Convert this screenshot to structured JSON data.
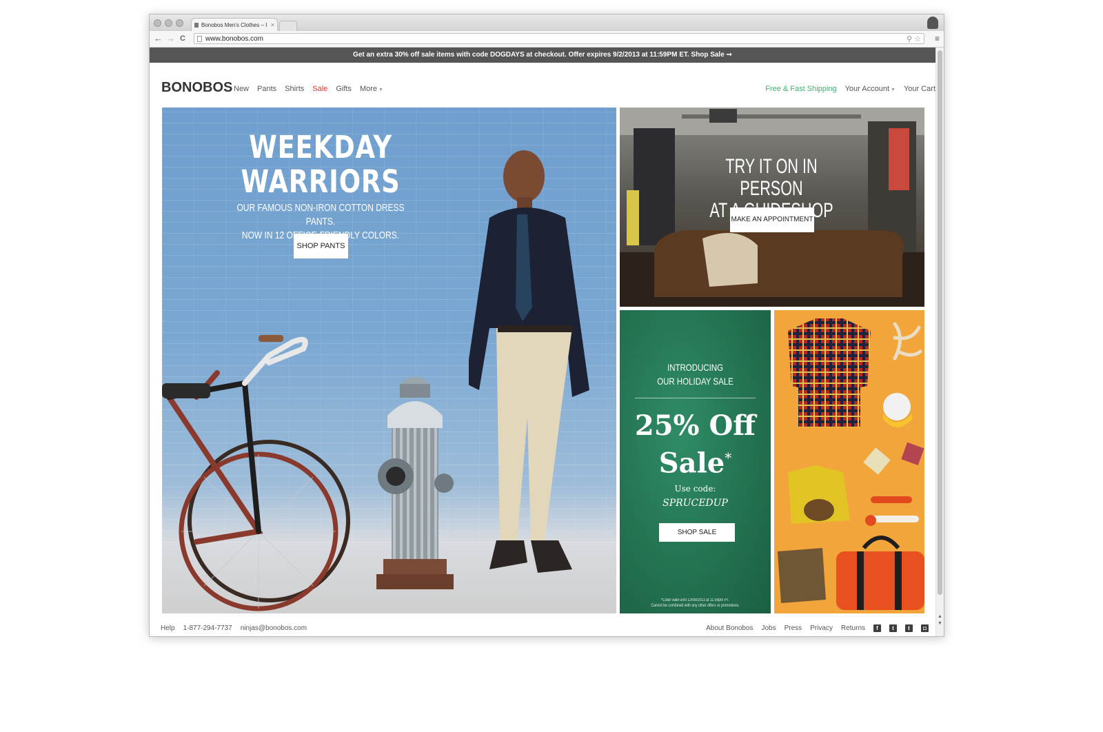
{
  "browser": {
    "tab_title": "Bonobos Men's Clothes – I",
    "tab_close": "×",
    "url": "www.bonobos.com",
    "back": "←",
    "forward": "→",
    "reload": "C",
    "omni_icons": "⚲ ☆",
    "menu": "≡"
  },
  "promo": {
    "text": "Get an extra 30% off sale items with code DOGDAYS at checkout. Offer expires 9/2/2013 at 11:59PM ET. Shop Sale ➞"
  },
  "header": {
    "logo": "BONOBOS",
    "nav": {
      "new": "New",
      "pants": "Pants",
      "shirts": "Shirts",
      "sale": "Sale",
      "gifts": "Gifts",
      "more": "More"
    },
    "util": {
      "shipping": "Free & Fast Shipping",
      "account": "Your Account",
      "cart": "Your Cart"
    },
    "colors": {
      "sale": "#e2332c",
      "shipping": "#3bb36a"
    }
  },
  "hero": {
    "title_line1": "WEEKDAY",
    "title_line2": "WARRIORS",
    "subtitle_line1": "OUR FAMOUS NON-IRON COTTON DRESS PANTS.",
    "subtitle_line2": "NOW IN 12 OFFICE-FRIENDLY COLORS.",
    "button": "SHOP PANTS"
  },
  "guideshop": {
    "title_line1": "TRY IT ON IN PERSON",
    "title_line2": "AT A GUIDESHOP",
    "button": "MAKE AN APPOINTMENT"
  },
  "holiday": {
    "intro_line1": "INTRODUCING",
    "intro_line2": "OUR HOLIDAY SALE",
    "big_line1": "25% Off",
    "big_line2": "Sale",
    "asterisk": "*",
    "code_label": "Use code:",
    "code": "SPRUCEDUP",
    "button": "SHOP SALE",
    "fine_line1": "*Code valid until 12/08/2013 at 11:59pm PT.",
    "fine_line2": "Cannot be combined with any other offers or promotions."
  },
  "footer": {
    "help": "Help",
    "phone": "1-877-294-7737",
    "email": "ninjas@bonobos.com",
    "about": "About Bonobos",
    "jobs": "Jobs",
    "press": "Press",
    "privacy": "Privacy",
    "returns": "Returns",
    "icons": [
      "facebook-icon",
      "twitter-icon",
      "tumblr-icon",
      "instagram-icon"
    ]
  }
}
